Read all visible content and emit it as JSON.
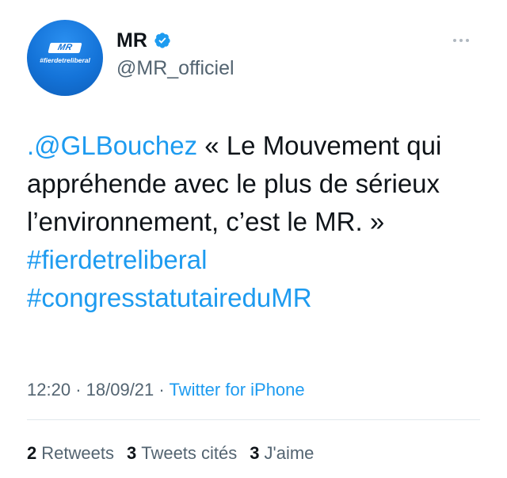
{
  "author": {
    "avatar_logo_text": "MR",
    "avatar_hashtag": "#fierdetreliberal",
    "display_name": "MR",
    "handle": "@MR_officiel",
    "verified": true
  },
  "tweet": {
    "mention": ".@GLBouchez",
    "text_part1": " « Le Mouvement qui appréhende avec le plus de sérieux l’environnement, c’est le MR. » ",
    "hashtag1": "#fierdetreliberal",
    "hashtag2": "#congresstatutaireduMR"
  },
  "meta": {
    "time": "12:20",
    "date": "18/09/21",
    "separator": "·",
    "source": "Twitter for iPhone"
  },
  "stats": {
    "retweets_count": "2",
    "retweets_label": "Retweets",
    "quotes_count": "3",
    "quotes_label": "Tweets cités",
    "likes_count": "3",
    "likes_label": "J'aime"
  },
  "colors": {
    "link": "#1d9bf0",
    "brand": "#1473d8",
    "muted": "#536471"
  }
}
